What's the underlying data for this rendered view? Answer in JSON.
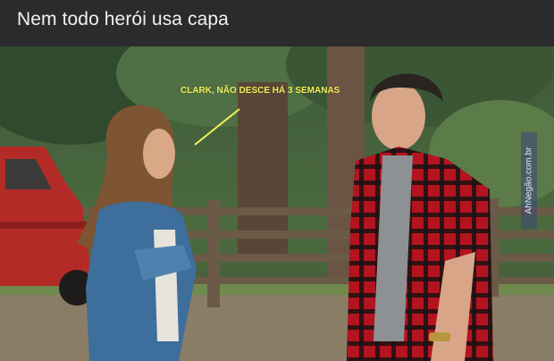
{
  "post": {
    "title": "Nem todo herói usa capa",
    "caption": "CLARK, NÃO DESCE HÁ 3 SEMANAS",
    "watermark": "AhNegão.com.br"
  },
  "colors": {
    "title_bar_bg": "#2b2b2d",
    "caption_text": "#f5f05a",
    "plaid_red": "#b3141f"
  },
  "icons": {
    "watermark": "ahnegao-logo-icon"
  }
}
